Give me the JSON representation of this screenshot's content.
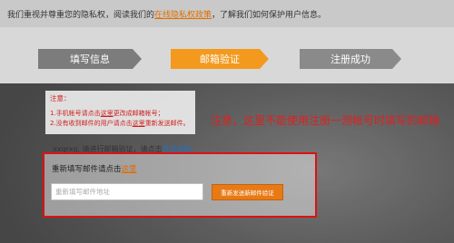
{
  "topbar": {
    "prefix": "我们重视并尊重您的隐私权，阅读我们的",
    "link": "在线隐私权政策",
    "suffix": "，了解我们如何保护用户信息。"
  },
  "steps": [
    "填写信息",
    "邮箱验证",
    "注册成功"
  ],
  "notice": {
    "title": "注意：",
    "line1_pre": "1.",
    "line1_mid": "手机帐号请点击",
    "line1_link": "这里",
    "line1_post": "更改成邮箱帐号；",
    "line2_pre": "2.没有收到邮件的用户请点击",
    "line2_link": "这里",
    "line2_post": "重新发送邮件。"
  },
  "annotation": "注意，这里不能使用注册一测帐号时填写的邮箱",
  "verify": {
    "text": "xxqrxg, 请进行邮箱验证，请点击",
    "link": "登录邮箱"
  },
  "resend": {
    "label": "重新填写邮件请点击",
    "link": "这里",
    "input_placeholder": "重新填写邮件地址",
    "button": "重新发送新邮件验证"
  }
}
